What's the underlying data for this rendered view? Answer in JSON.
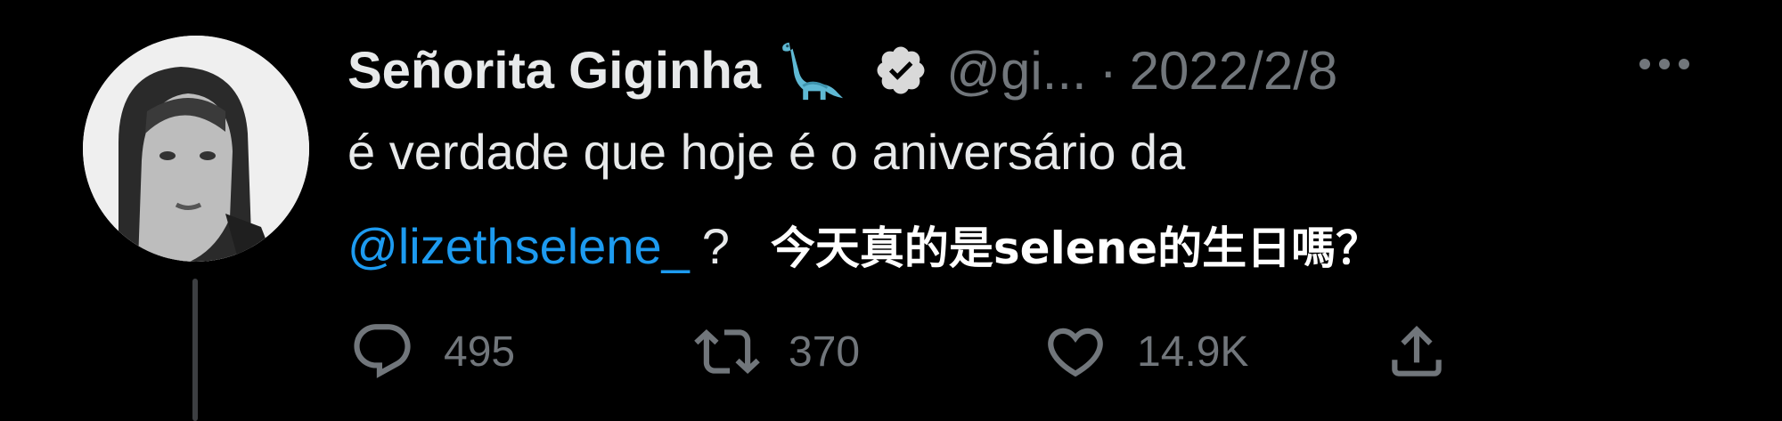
{
  "tweet": {
    "display_name": "Señorita Giginha",
    "handle": "@gi...",
    "separator": "·",
    "timestamp": "2022/2/8",
    "text_line1": "é verdade que hoje é o aniversário da",
    "mention": "@lizethselene_",
    "question_mark": "?",
    "caption_cjk": "今天真的是selene的生日嗎？",
    "replies": "495",
    "retweets": "370",
    "likes": "14.9K"
  },
  "icons": {
    "name_emoji": "sauropod-dinosaur-emoji",
    "verified": "verified-badge-icon",
    "more": "more-icon",
    "reply": "reply-icon",
    "retweet": "retweet-icon",
    "like": "heart-icon",
    "share": "share-icon"
  },
  "colors": {
    "background": "#000000",
    "text": "#e7e9ea",
    "secondary": "#71767b",
    "mention": "#1d9bf0",
    "dino": "#5fb9d4"
  }
}
